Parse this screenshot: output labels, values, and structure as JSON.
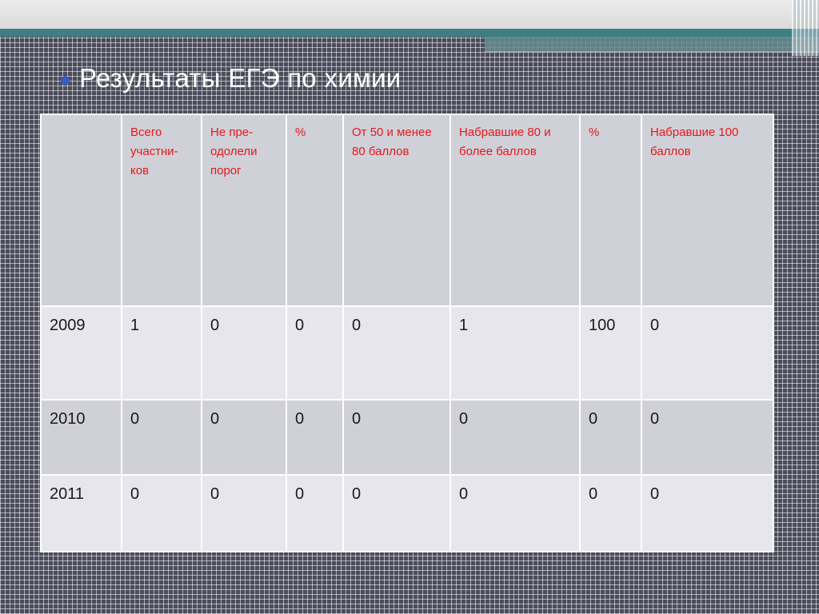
{
  "slide": {
    "title": "Результаты  ЕГЭ по химии",
    "colors": {
      "header_text": "#e21a1a",
      "bullet": "#3a5bbf",
      "accent_teal": "#3f7f84"
    }
  },
  "table": {
    "headers": [
      "",
      "Всего участни-ков",
      "Не пре-одолели порог",
      "%",
      "От 50 и менее 80 баллов",
      "Набравшие 80 и более баллов",
      "%",
      "Набравшие 100 баллов"
    ],
    "rows": [
      [
        "2009",
        "1",
        "0",
        "0",
        "0",
        "1",
        "100",
        "0"
      ],
      [
        "2010",
        "0",
        "0",
        "0",
        "0",
        "0",
        "0",
        "0"
      ],
      [
        "2011",
        "0",
        "0",
        "0",
        "0",
        "0",
        "0",
        "0"
      ]
    ]
  }
}
